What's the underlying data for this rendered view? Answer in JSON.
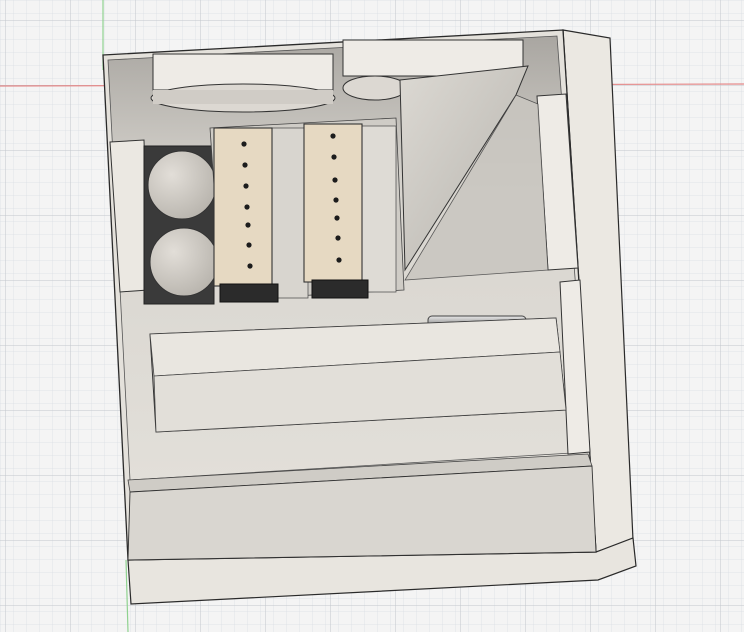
{
  "viewport": {
    "background": "#f4f4f4",
    "grid_minor_color": "#dcdfe4",
    "grid_major_color": "#c2c6cc",
    "axis_x_color": "#e58a8a",
    "axis_y_color": "#8fd28f"
  },
  "model": {
    "body_color": "#e8e5df",
    "edge_color": "#2a2a2a",
    "interior_color": "#d9d6d0",
    "shadow_color": "#9c9994",
    "part_beige": "#e6d9c2",
    "dark_part": "#2b2b2b",
    "battery_color": "#cfcbc4",
    "rod_color": "#b8b8b8",
    "hole_count_per_board": 7,
    "battery_count": 2,
    "fan_count": 2
  }
}
